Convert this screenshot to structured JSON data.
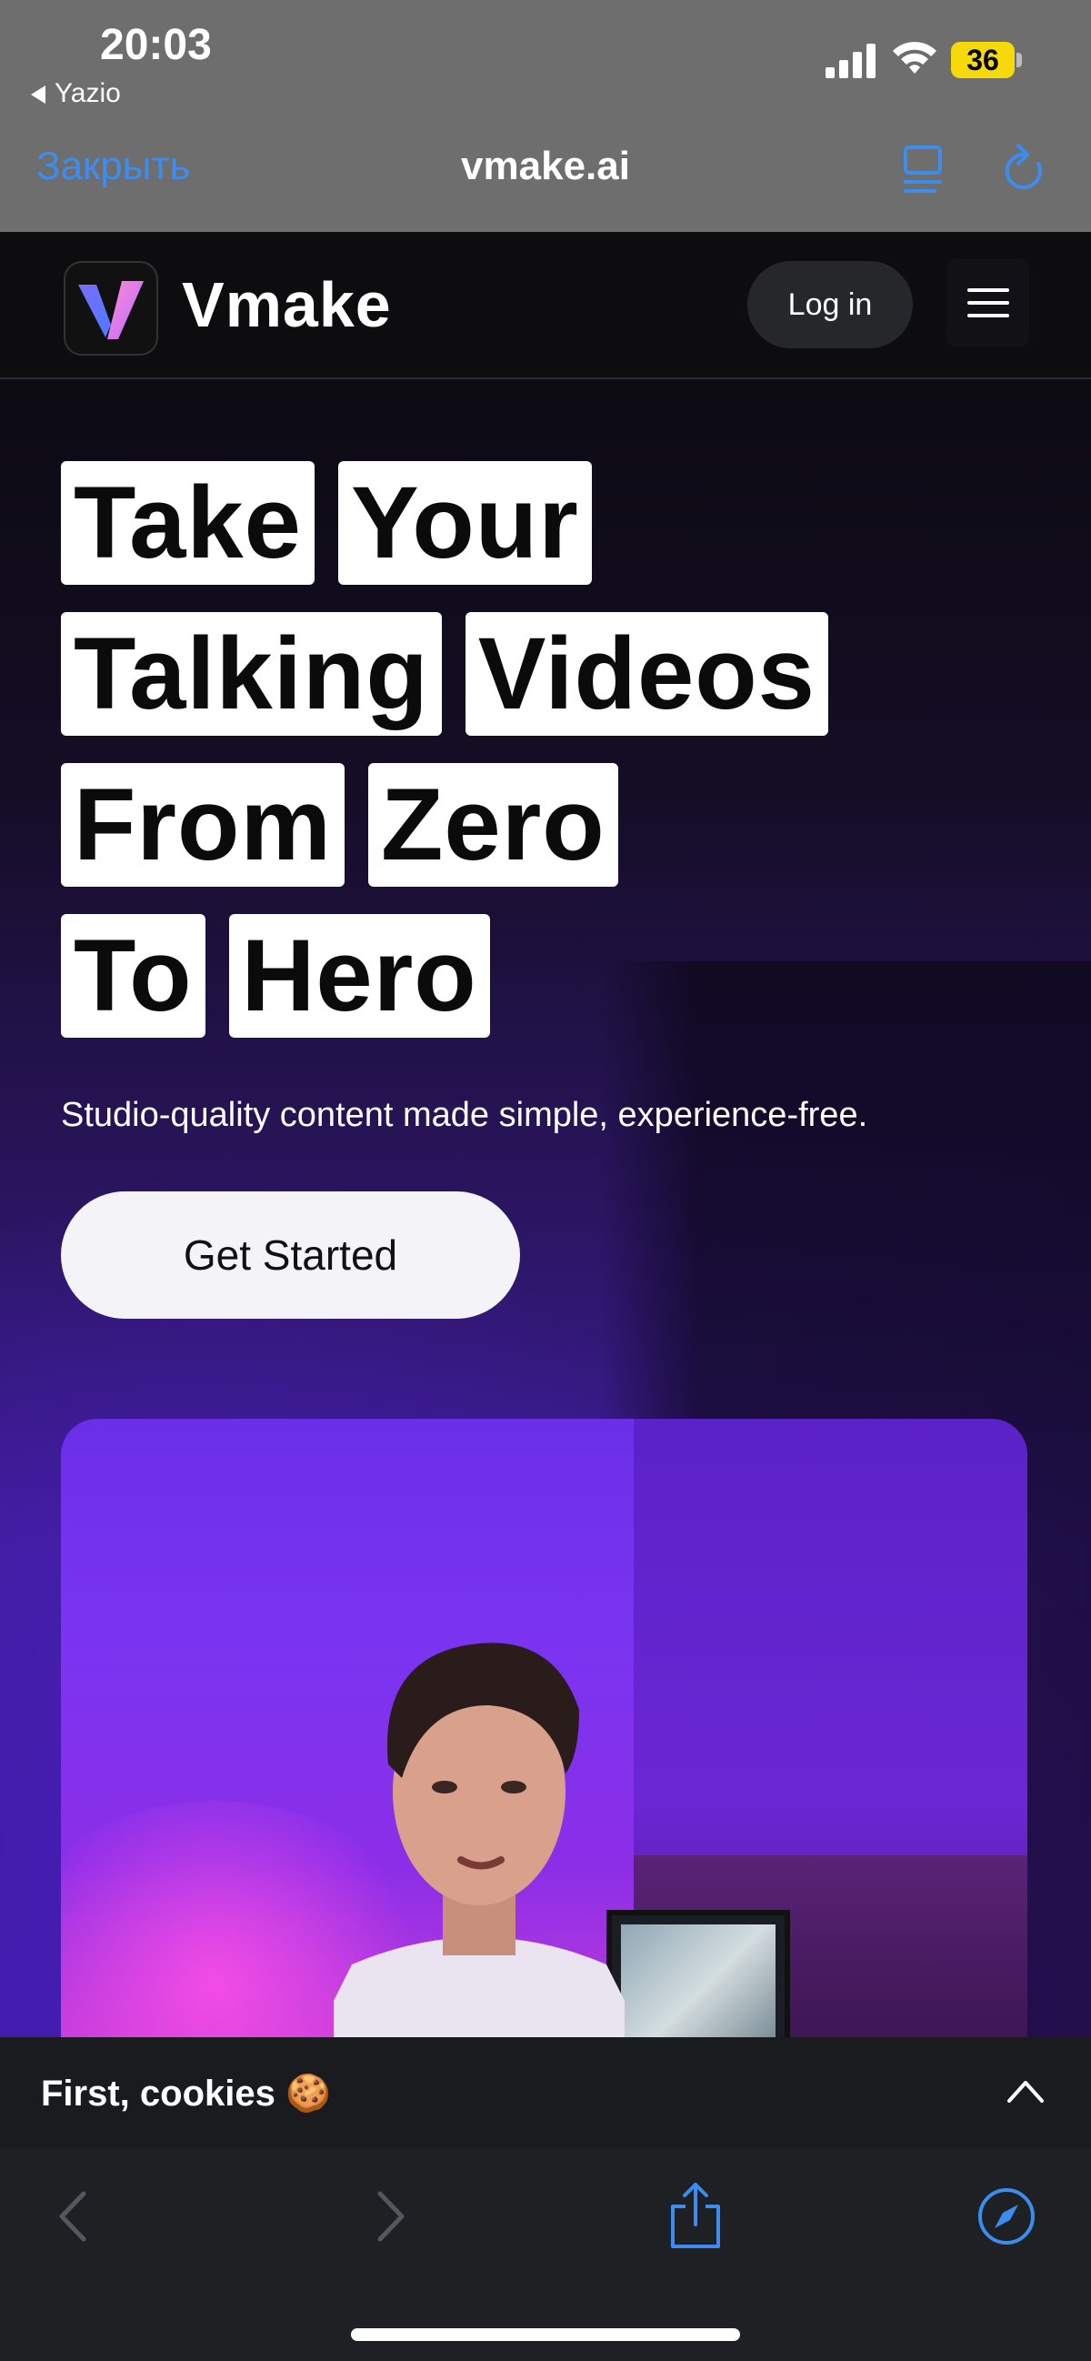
{
  "status_bar": {
    "time": "20:03",
    "back_app": "Yazio",
    "battery": "36",
    "battery_color": "#f5d90a"
  },
  "safari_bar": {
    "close_label": "Закрыть",
    "url": "vmake.ai",
    "accent": "#3d8cf0",
    "icons": [
      "reader-icon",
      "reload-icon"
    ]
  },
  "site": {
    "brand": "Vmake",
    "login_label": "Log in",
    "menu_icon": "hamburger-icon"
  },
  "hero": {
    "headline_rows": [
      [
        "Take",
        "Your"
      ],
      [
        "Talking",
        "Videos"
      ],
      [
        "From",
        "Zero"
      ],
      [
        "To",
        "Hero"
      ]
    ],
    "subtitle": "Studio-quality content made simple, experience-free.",
    "cta_label": "Get Started"
  },
  "cookie_bar": {
    "label": "First, cookies 🍪",
    "chevron_icon": "chevron-up-icon"
  },
  "toolbar": {
    "icons": [
      "back-arrow-icon",
      "forward-arrow-icon",
      "share-icon",
      "compass-icon"
    ]
  }
}
